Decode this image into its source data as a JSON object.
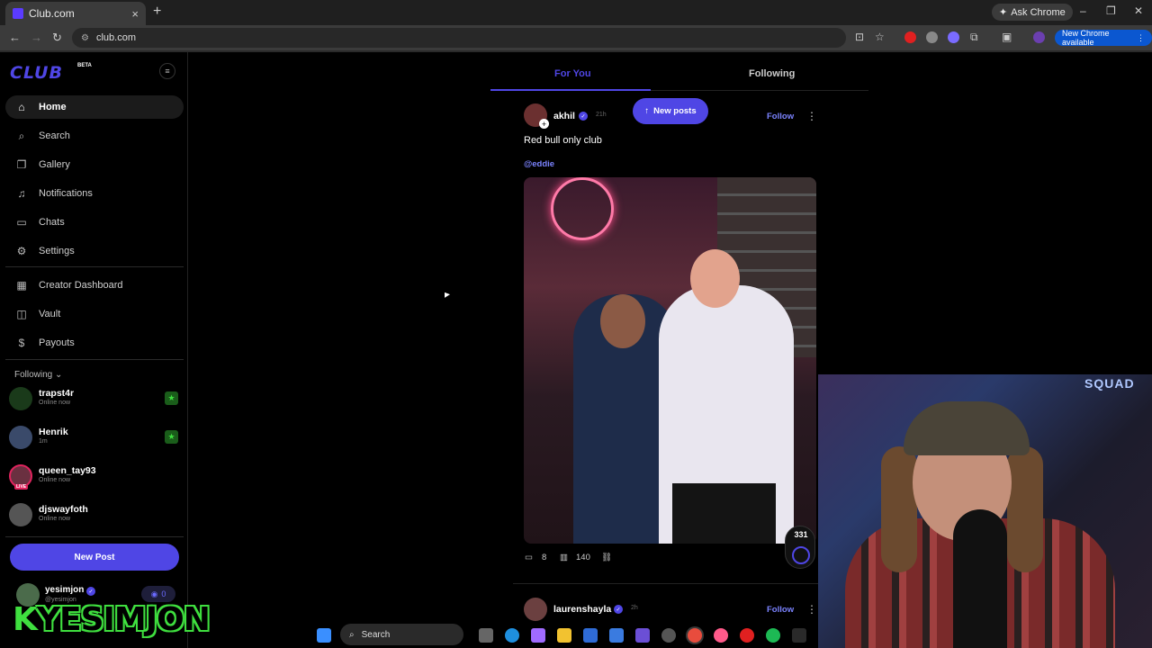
{
  "browser": {
    "tab_title": "Club.com",
    "tab_close": "×",
    "new_tab": "+",
    "ask_chrome": "Ask Chrome",
    "url": "club.com",
    "update_label": "New Chrome available",
    "win_min": "–",
    "win_max": "❐",
    "win_close": "✕"
  },
  "sidebar": {
    "logo": "CLUB",
    "beta": "BETA",
    "nav": [
      {
        "label": "Home",
        "icon": "home-icon"
      },
      {
        "label": "Search",
        "icon": "search-icon"
      },
      {
        "label": "Gallery",
        "icon": "gallery-icon"
      },
      {
        "label": "Notifications",
        "icon": "bell-icon"
      },
      {
        "label": "Chats",
        "icon": "chat-icon"
      },
      {
        "label": "Settings",
        "icon": "gear-icon"
      },
      {
        "label": "Creator Dashboard",
        "icon": "dashboard-icon"
      },
      {
        "label": "Vault",
        "icon": "vault-icon"
      },
      {
        "label": "Payouts",
        "icon": "dollar-icon"
      }
    ],
    "following_label": "Following",
    "following": [
      {
        "name": "trapst4r",
        "status": "Online now"
      },
      {
        "name": "Henrik",
        "status": "1m"
      },
      {
        "name": "queen_tay93",
        "status": "Online now",
        "live": "LIVE"
      },
      {
        "name": "djswayfoth",
        "status": "Online now"
      }
    ],
    "new_post": "New Post",
    "me": {
      "name": "yesimjon",
      "handle": "@yesimjon",
      "badge_count": "0"
    }
  },
  "feed": {
    "tabs": [
      "For You",
      "Following"
    ],
    "new_posts": "New posts",
    "post1": {
      "author": "akhil",
      "time": "21h",
      "follow": "Follow",
      "text": "Red bull only club",
      "mention": "@eddie",
      "boost_count": "331",
      "comments": "8",
      "views": "140"
    },
    "post2": {
      "author": "laurenshayla",
      "time": "2h",
      "follow": "Follow"
    }
  },
  "overlay": {
    "k": "K",
    "brand": "YESIMJON",
    "sign": "SQUAD"
  },
  "taskbar": {
    "search": "Search"
  },
  "colors": {
    "accent": "#4f46e5",
    "link": "#7b83ff",
    "background": "#000000"
  }
}
